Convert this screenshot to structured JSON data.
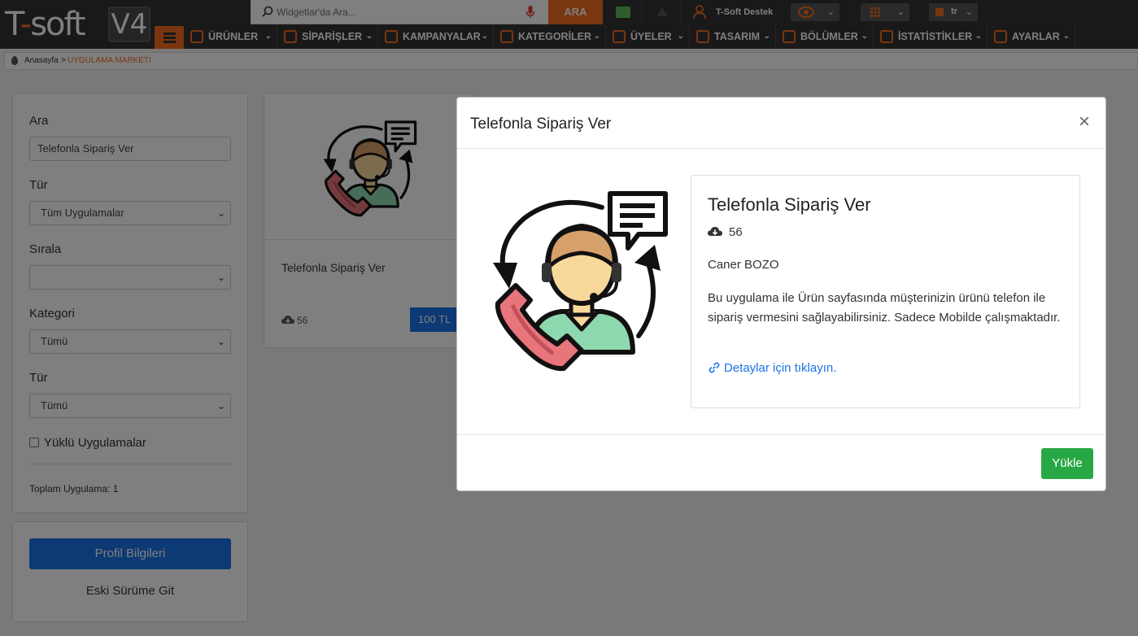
{
  "brand": {
    "logo_text": "T-soft",
    "version_badge": "V4",
    "accent": "#f26c1f"
  },
  "topbar": {
    "search_placeholder": "Widgetlar'da Ara...",
    "search_button": "ARA",
    "user_label": "T-Soft Destek",
    "language": "tr",
    "icons": [
      "search-icon",
      "microphone-icon",
      "chat-icon",
      "warning-icon",
      "user-icon",
      "eye-icon",
      "grid-icon",
      "flag-icon"
    ]
  },
  "nav": {
    "items": [
      {
        "label": "ÜRÜNLER",
        "icon": "products-icon"
      },
      {
        "label": "SİPARİŞLER",
        "icon": "cart-icon"
      },
      {
        "label": "KAMPANYALAR",
        "icon": "tag-icon"
      },
      {
        "label": "KATEGORİLER",
        "icon": "sitemap-icon"
      },
      {
        "label": "ÜYELER",
        "icon": "users-icon"
      },
      {
        "label": "TASARIM",
        "icon": "brush-icon"
      },
      {
        "label": "BÖLÜMLER",
        "icon": "sections-icon"
      },
      {
        "label": "İSTATİSTİKLER",
        "icon": "chart-icon"
      },
      {
        "label": "AYARLAR",
        "icon": "settings-icon"
      }
    ]
  },
  "breadcrumb": {
    "home": "Anasayfa",
    "separator": ">",
    "current": "UYGULAMA MARKETİ"
  },
  "filters": {
    "search_label": "Ara",
    "search_value": "Telefonla Sipariş Ver",
    "type_label": "Tür",
    "type_value": "Tüm Uygulamalar",
    "sort_label": "Sırala",
    "sort_value": "",
    "category_label": "Kategori",
    "category_value": "Tümü",
    "type2_label": "Tür",
    "type2_value": "Tümü",
    "installed_label": "Yüklü Uygulamalar",
    "total_label": "Toplam Uygulama: 1"
  },
  "profile": {
    "profile_button": "Profil Bilgileri",
    "old_version_link": "Eski Sürüme Git"
  },
  "app_card": {
    "title": "Telefonla Sipariş Ver",
    "downloads": "56",
    "price": "100 TL"
  },
  "modal": {
    "title": "Telefonla Sipariş Ver",
    "close": "×",
    "app_title": "Telefonla Sipariş Ver",
    "downloads": "56",
    "author": "Caner BOZO",
    "description": "Bu uygulama ile Ürün sayfasında müşterinizin ürünü telefon ile sipariş vermesini sağlayabilirsiniz. Sadece Mobilde çalışmaktadır.",
    "details_link": "Detaylar için tıklayın.",
    "install_button": "Yükle",
    "colors": {
      "install": "#28a745",
      "link": "#1a73e8"
    }
  }
}
